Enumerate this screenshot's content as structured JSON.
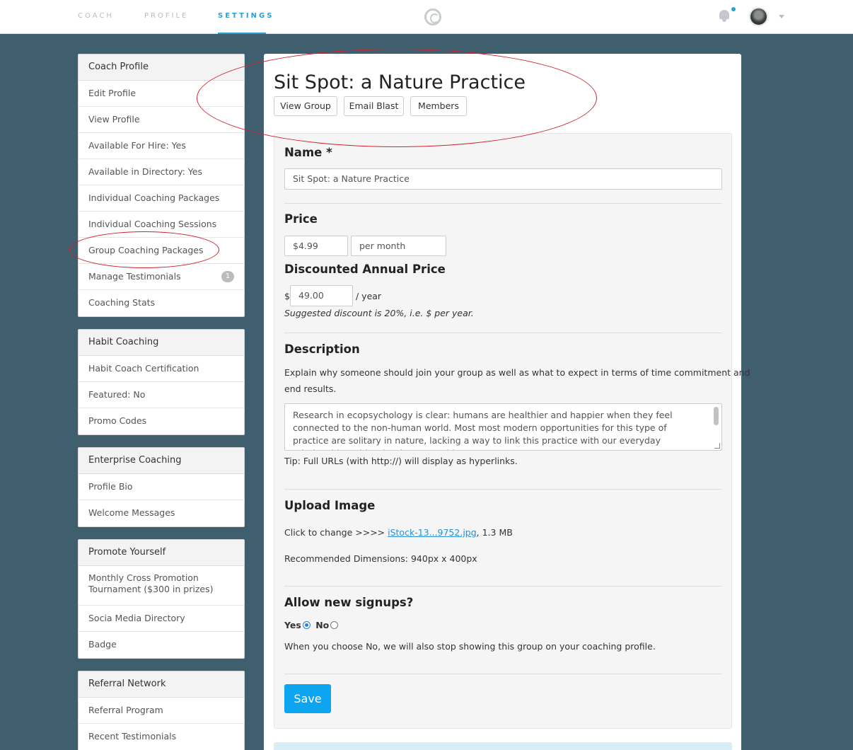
{
  "nav": {
    "coach": "COACH",
    "profile": "PROFILE",
    "settings": "SETTINGS"
  },
  "icons": {
    "logo": "c-logo-icon",
    "notifications": "bell-icon",
    "avatar": "user-avatar",
    "menu": "chevron-down-icon"
  },
  "colors": {
    "accent": "#2a9fd6",
    "save_button": "#0ea5f0",
    "annotation": "#d0202e",
    "background": "#3f5f6e"
  },
  "sidebar": {
    "coach_profile": {
      "title": "Coach Profile",
      "items": [
        "Edit Profile",
        "View Profile",
        "Available For Hire: Yes",
        "Available in Directory: Yes",
        "Individual Coaching Packages",
        "Individual Coaching Sessions",
        "Group Coaching Packages",
        "Manage Testimonials",
        "Coaching Stats"
      ],
      "testimonials_badge": "1"
    },
    "habit_coaching": {
      "title": "Habit Coaching",
      "items": [
        "Habit Coach Certification",
        "Featured: No",
        "Promo Codes"
      ]
    },
    "enterprise_coaching": {
      "title": "Enterprise Coaching",
      "items": [
        "Profile Bio",
        "Welcome Messages"
      ]
    },
    "promote_yourself": {
      "title": "Promote Yourself",
      "items": [
        "Monthly Cross Promotion Tournament ($300 in prizes)",
        "Socia Media Directory",
        "Badge"
      ]
    },
    "referral_network": {
      "title": "Referral Network",
      "items": [
        "Referral Program",
        "Recent Testimonials"
      ]
    }
  },
  "main": {
    "title": "Sit Spot: a Nature Practice",
    "buttons": {
      "view_group": "View Group",
      "email_blast": "Email Blast",
      "members": "Members"
    },
    "form": {
      "name_label": "Name *",
      "name_value": "Sit Spot: a Nature Practice",
      "price_label": "Price",
      "price_value": "$4.99",
      "price_period": "per month",
      "annual_label": "Discounted Annual Price",
      "annual_currency": "$",
      "annual_value": "49.00",
      "annual_suffix": "/ year",
      "annual_hint": "Suggested discount is 20%, i.e. $ per year.",
      "description_label": "Description",
      "description_help_1": "Explain why someone should join your group as well as what to expect in terms of time commitment and",
      "description_help_2": "end results.",
      "description_value": "Research in ecopsychology is clear: humans are healthier and happier when they feel connected to the non-human world. Most most modern opportunities for this type of practice are solitary in nature, lacking a way to link this practice with our everyday relationships with other humans. This",
      "description_tip": "Tip: Full URLs (with http://) will display as hyperlinks.",
      "upload_label": "Upload Image",
      "upload_prefix": "Click to change >>>> ",
      "upload_file": "iStock-13...9752.jpg",
      "upload_size": ", 1.3 MB",
      "upload_dimensions": "Recommended Dimensions: 940px x 400px",
      "signups_label": "Allow new signups?",
      "signups_yes": "Yes",
      "signups_no": "No",
      "signups_selected": "Yes",
      "signups_note": "When you choose No, we will also stop showing this group on your coaching profile.",
      "save_label": "Save"
    }
  }
}
